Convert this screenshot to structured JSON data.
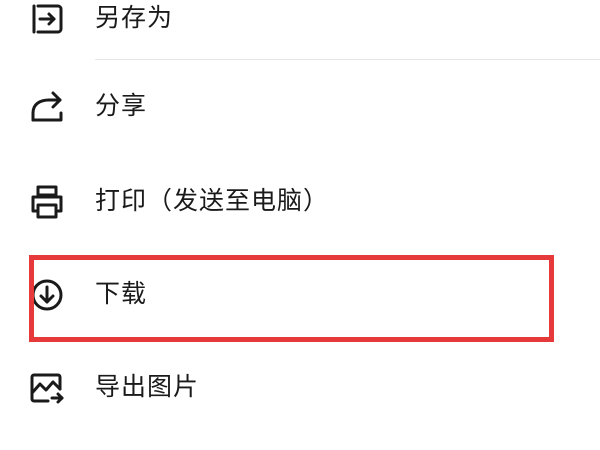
{
  "menu": {
    "items": [
      {
        "label": "另存为",
        "icon": "save-as-icon"
      },
      {
        "label": "分享",
        "icon": "share-icon"
      },
      {
        "label": "打印（发送至电脑）",
        "icon": "printer-icon"
      },
      {
        "label": "下载",
        "icon": "download-icon"
      },
      {
        "label": "导出图片",
        "icon": "export-image-icon"
      }
    ]
  },
  "highlight": {
    "target": "下载",
    "color": "#e63a3a"
  },
  "colors": {
    "text": "#1a1a1a",
    "divider": "#e6e6e6",
    "background": "#ffffff"
  }
}
